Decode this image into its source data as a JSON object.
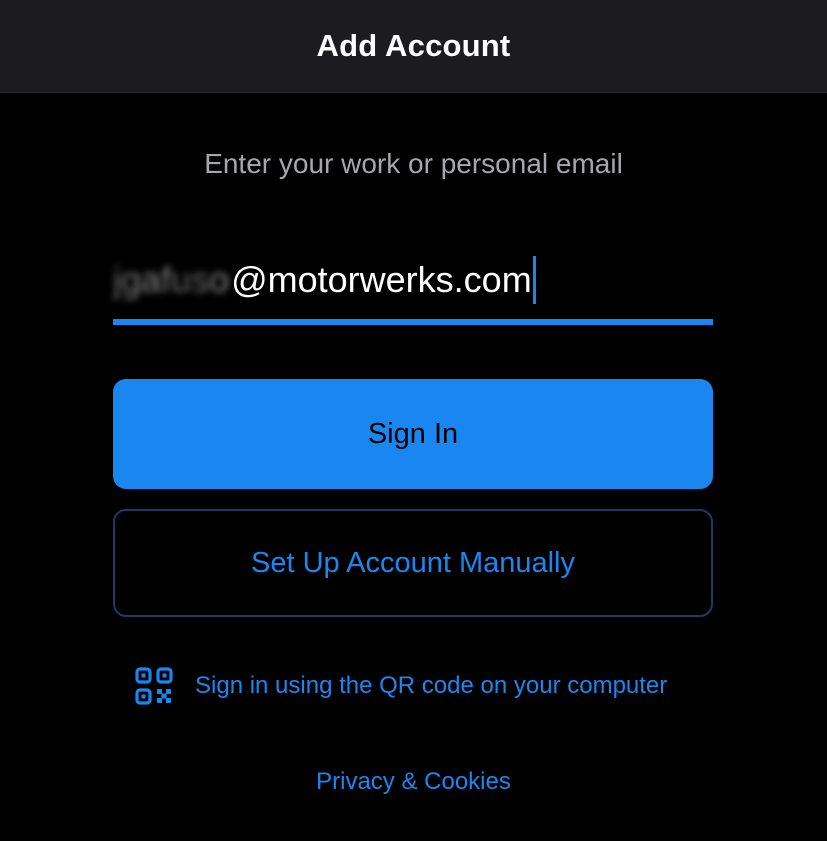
{
  "header": {
    "title": "Add Account"
  },
  "form": {
    "prompt": "Enter your work or personal email",
    "email_local_part": "jgafuso",
    "email_domain": "@motorwerks.com"
  },
  "buttons": {
    "sign_in_label": "Sign In",
    "manual_setup_label": "Set Up Account Manually"
  },
  "qr_link": {
    "label": "Sign in using the QR code on your computer",
    "icon": "qr-code-icon"
  },
  "footer": {
    "privacy_label": "Privacy & Cookies"
  },
  "colors": {
    "accent": "#1a87f1",
    "background": "#000000",
    "nav_background": "#1c1c1e",
    "prompt_text": "#a6a6ab"
  }
}
